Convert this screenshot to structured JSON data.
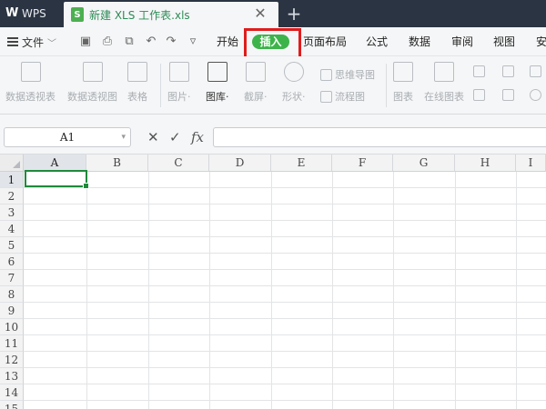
{
  "titlebar": {
    "app_tab_label": "WPS",
    "doc_tab_title": "新建 XLS 工作表.xls",
    "close_glyph": "✕",
    "new_tab_glyph": "+"
  },
  "menu": {
    "file_label": "文件",
    "tabs": [
      "开始",
      "插入",
      "页面布局",
      "公式",
      "数据",
      "审阅",
      "视图",
      "安"
    ],
    "active_tab": "插入"
  },
  "ribbon": {
    "items": [
      {
        "label": "数据透视表",
        "icon": "pivot-table-icon",
        "enabled": false
      },
      {
        "label": "数据透视图",
        "icon": "pivot-chart-icon",
        "enabled": false
      },
      {
        "label": "表格",
        "icon": "table-icon",
        "enabled": false
      },
      {
        "label": "图片·",
        "icon": "picture-icon",
        "enabled": false
      },
      {
        "label": "图库·",
        "icon": "gallery-icon",
        "enabled": true
      },
      {
        "label": "截屏·",
        "icon": "screenshot-icon",
        "enabled": false
      },
      {
        "label": "形状·",
        "icon": "shape-icon",
        "enabled": false
      },
      {
        "label": "图表",
        "icon": "chart-icon",
        "enabled": false
      },
      {
        "label": "在线图表",
        "icon": "online-chart-icon",
        "enabled": false
      }
    ],
    "small_items": [
      {
        "label": "思维导图",
        "icon": "mindmap-icon"
      },
      {
        "label": "流程图",
        "icon": "flowchart-icon"
      }
    ]
  },
  "formula_bar": {
    "name_box": "A1",
    "cancel_glyph": "✕",
    "confirm_glyph": "✓",
    "fx_label": "fx",
    "formula_value": ""
  },
  "sheet": {
    "columns": [
      "A",
      "B",
      "C",
      "D",
      "E",
      "F",
      "G",
      "H",
      "I"
    ],
    "rows": [
      "1",
      "2",
      "3",
      "4",
      "5",
      "6",
      "7",
      "8",
      "9",
      "10",
      "11",
      "12",
      "13",
      "14",
      "15"
    ],
    "active_cell": "A1"
  },
  "colors": {
    "titlebar_bg": "#2b3442",
    "insert_pill": "#3cb44a",
    "highlight_box": "#e01c1c",
    "active_cell_border": "#1f8a3b"
  }
}
